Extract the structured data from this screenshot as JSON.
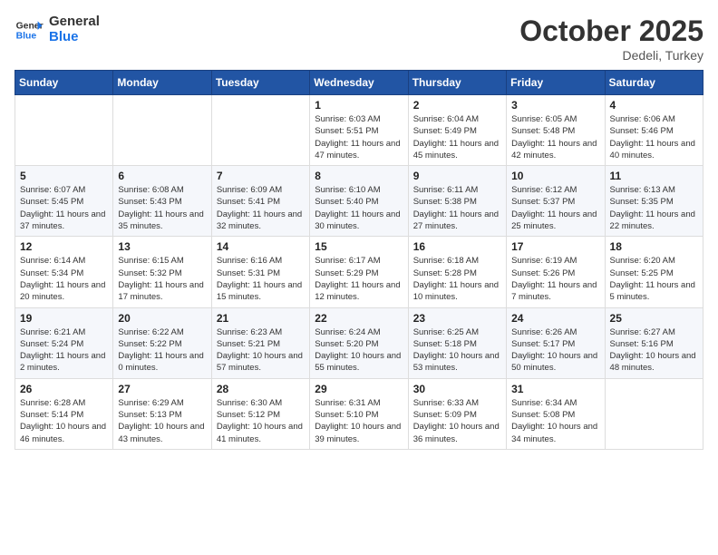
{
  "header": {
    "logo_general": "General",
    "logo_blue": "Blue",
    "month": "October 2025",
    "location": "Dedeli, Turkey"
  },
  "days_of_week": [
    "Sunday",
    "Monday",
    "Tuesday",
    "Wednesday",
    "Thursday",
    "Friday",
    "Saturday"
  ],
  "weeks": [
    [
      {
        "day": "",
        "info": ""
      },
      {
        "day": "",
        "info": ""
      },
      {
        "day": "",
        "info": ""
      },
      {
        "day": "1",
        "info": "Sunrise: 6:03 AM\nSunset: 5:51 PM\nDaylight: 11 hours and 47 minutes."
      },
      {
        "day": "2",
        "info": "Sunrise: 6:04 AM\nSunset: 5:49 PM\nDaylight: 11 hours and 45 minutes."
      },
      {
        "day": "3",
        "info": "Sunrise: 6:05 AM\nSunset: 5:48 PM\nDaylight: 11 hours and 42 minutes."
      },
      {
        "day": "4",
        "info": "Sunrise: 6:06 AM\nSunset: 5:46 PM\nDaylight: 11 hours and 40 minutes."
      }
    ],
    [
      {
        "day": "5",
        "info": "Sunrise: 6:07 AM\nSunset: 5:45 PM\nDaylight: 11 hours and 37 minutes."
      },
      {
        "day": "6",
        "info": "Sunrise: 6:08 AM\nSunset: 5:43 PM\nDaylight: 11 hours and 35 minutes."
      },
      {
        "day": "7",
        "info": "Sunrise: 6:09 AM\nSunset: 5:41 PM\nDaylight: 11 hours and 32 minutes."
      },
      {
        "day": "8",
        "info": "Sunrise: 6:10 AM\nSunset: 5:40 PM\nDaylight: 11 hours and 30 minutes."
      },
      {
        "day": "9",
        "info": "Sunrise: 6:11 AM\nSunset: 5:38 PM\nDaylight: 11 hours and 27 minutes."
      },
      {
        "day": "10",
        "info": "Sunrise: 6:12 AM\nSunset: 5:37 PM\nDaylight: 11 hours and 25 minutes."
      },
      {
        "day": "11",
        "info": "Sunrise: 6:13 AM\nSunset: 5:35 PM\nDaylight: 11 hours and 22 minutes."
      }
    ],
    [
      {
        "day": "12",
        "info": "Sunrise: 6:14 AM\nSunset: 5:34 PM\nDaylight: 11 hours and 20 minutes."
      },
      {
        "day": "13",
        "info": "Sunrise: 6:15 AM\nSunset: 5:32 PM\nDaylight: 11 hours and 17 minutes."
      },
      {
        "day": "14",
        "info": "Sunrise: 6:16 AM\nSunset: 5:31 PM\nDaylight: 11 hours and 15 minutes."
      },
      {
        "day": "15",
        "info": "Sunrise: 6:17 AM\nSunset: 5:29 PM\nDaylight: 11 hours and 12 minutes."
      },
      {
        "day": "16",
        "info": "Sunrise: 6:18 AM\nSunset: 5:28 PM\nDaylight: 11 hours and 10 minutes."
      },
      {
        "day": "17",
        "info": "Sunrise: 6:19 AM\nSunset: 5:26 PM\nDaylight: 11 hours and 7 minutes."
      },
      {
        "day": "18",
        "info": "Sunrise: 6:20 AM\nSunset: 5:25 PM\nDaylight: 11 hours and 5 minutes."
      }
    ],
    [
      {
        "day": "19",
        "info": "Sunrise: 6:21 AM\nSunset: 5:24 PM\nDaylight: 11 hours and 2 minutes."
      },
      {
        "day": "20",
        "info": "Sunrise: 6:22 AM\nSunset: 5:22 PM\nDaylight: 11 hours and 0 minutes."
      },
      {
        "day": "21",
        "info": "Sunrise: 6:23 AM\nSunset: 5:21 PM\nDaylight: 10 hours and 57 minutes."
      },
      {
        "day": "22",
        "info": "Sunrise: 6:24 AM\nSunset: 5:20 PM\nDaylight: 10 hours and 55 minutes."
      },
      {
        "day": "23",
        "info": "Sunrise: 6:25 AM\nSunset: 5:18 PM\nDaylight: 10 hours and 53 minutes."
      },
      {
        "day": "24",
        "info": "Sunrise: 6:26 AM\nSunset: 5:17 PM\nDaylight: 10 hours and 50 minutes."
      },
      {
        "day": "25",
        "info": "Sunrise: 6:27 AM\nSunset: 5:16 PM\nDaylight: 10 hours and 48 minutes."
      }
    ],
    [
      {
        "day": "26",
        "info": "Sunrise: 6:28 AM\nSunset: 5:14 PM\nDaylight: 10 hours and 46 minutes."
      },
      {
        "day": "27",
        "info": "Sunrise: 6:29 AM\nSunset: 5:13 PM\nDaylight: 10 hours and 43 minutes."
      },
      {
        "day": "28",
        "info": "Sunrise: 6:30 AM\nSunset: 5:12 PM\nDaylight: 10 hours and 41 minutes."
      },
      {
        "day": "29",
        "info": "Sunrise: 6:31 AM\nSunset: 5:10 PM\nDaylight: 10 hours and 39 minutes."
      },
      {
        "day": "30",
        "info": "Sunrise: 6:33 AM\nSunset: 5:09 PM\nDaylight: 10 hours and 36 minutes."
      },
      {
        "day": "31",
        "info": "Sunrise: 6:34 AM\nSunset: 5:08 PM\nDaylight: 10 hours and 34 minutes."
      },
      {
        "day": "",
        "info": ""
      }
    ]
  ]
}
